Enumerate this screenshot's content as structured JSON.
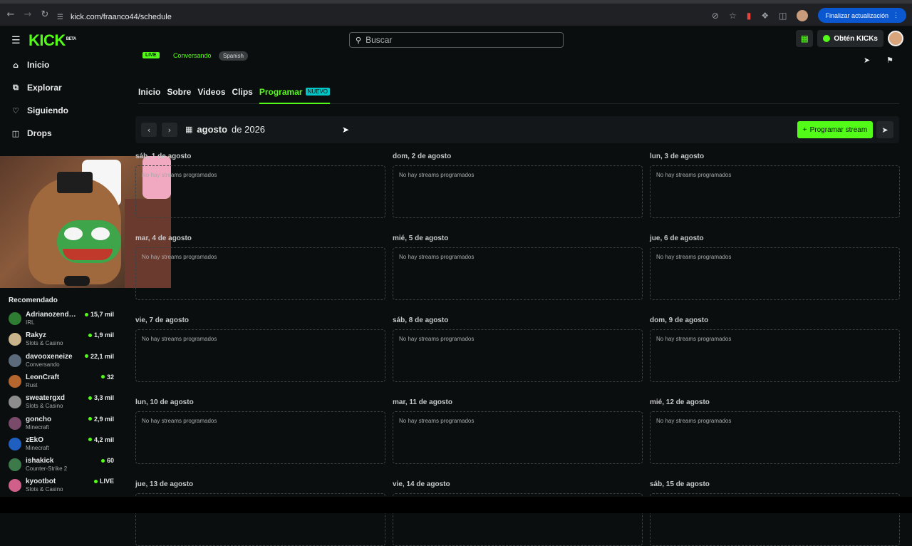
{
  "browser": {
    "url": "kick.com/fraanco44/schedule",
    "update_label": "Finalizar actualización"
  },
  "header": {
    "logo": "KICK",
    "logo_tag": "BETA",
    "search_placeholder": "Buscar",
    "kicks_label": "Obtén KICKs"
  },
  "sidebar": {
    "items": [
      {
        "label": "Inicio"
      },
      {
        "label": "Explorar"
      },
      {
        "label": "Siguiendo"
      },
      {
        "label": "Drops"
      }
    ],
    "recommended_title": "Recomendado",
    "recommended": [
      {
        "name": "Adrianozendej...",
        "category": "IRL",
        "viewers": "15,7 mil",
        "color": "#2e7d32"
      },
      {
        "name": "Rakyz",
        "category": "Slots & Casino",
        "viewers": "1,9 mil",
        "color": "#c9b38a"
      },
      {
        "name": "davooxeneize",
        "category": "Conversando",
        "viewers": "22,1 mil",
        "color": "#5b6b7c"
      },
      {
        "name": "LeonCraft",
        "category": "Rust",
        "viewers": "32",
        "color": "#b5662f"
      },
      {
        "name": "sweatergxd",
        "category": "Slots & Casino",
        "viewers": "3,3 mil",
        "color": "#8d8d8d"
      },
      {
        "name": "goncho",
        "category": "Minecraft",
        "viewers": "2,9 mil",
        "color": "#7a4a6b"
      },
      {
        "name": "zEkO",
        "category": "Minecraft",
        "viewers": "4,2 mil",
        "color": "#1f5fbf"
      },
      {
        "name": "ishakick",
        "category": "Counter-Strike 2",
        "viewers": "60",
        "color": "#3d7a4a"
      },
      {
        "name": "kyootbot",
        "category": "Slots & Casino",
        "viewers": "LIVE",
        "color": "#d0608a"
      }
    ]
  },
  "channel": {
    "live_badge": "LIVE",
    "category": "Conversando",
    "language": "Spanish"
  },
  "tabs": [
    {
      "label": "Inicio"
    },
    {
      "label": "Sobre"
    },
    {
      "label": "Videos"
    },
    {
      "label": "Clips"
    },
    {
      "label": "Programar",
      "badge": "NUEVO"
    }
  ],
  "schedule": {
    "month_bold": "agosto",
    "month_rest": "de 2026",
    "program_button": "Programar stream",
    "empty_text": "No hay streams programados",
    "days": [
      "sáb, 1 de agosto",
      "dom, 2 de agosto",
      "lun, 3 de agosto",
      "mar, 4 de agosto",
      "mié, 5 de agosto",
      "jue, 6 de agosto",
      "vie, 7 de agosto",
      "sáb, 8 de agosto",
      "dom, 9 de agosto",
      "lun, 10 de agosto",
      "mar, 11 de agosto",
      "mié, 12 de agosto",
      "jue, 13 de agosto",
      "vie, 14 de agosto",
      "sáb, 15 de agosto"
    ]
  }
}
